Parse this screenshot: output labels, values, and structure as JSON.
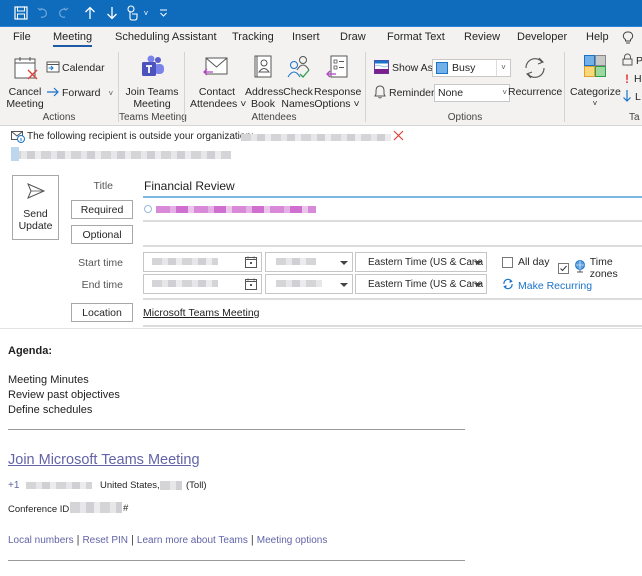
{
  "quick_access": {
    "icons": [
      "save-icon",
      "undo-icon",
      "redo-icon",
      "previous-item-icon",
      "next-item-icon",
      "touch-mode-icon",
      "touch-dropdown-icon",
      "customize-toolbar-icon"
    ]
  },
  "tabs": [
    {
      "label": "File",
      "active": false
    },
    {
      "label": "Meeting",
      "active": true
    },
    {
      "label": "Scheduling Assistant",
      "active": false
    },
    {
      "label": "Tracking",
      "active": false
    },
    {
      "label": "Insert",
      "active": false
    },
    {
      "label": "Draw",
      "active": false
    },
    {
      "label": "Format Text",
      "active": false
    },
    {
      "label": "Review",
      "active": false
    },
    {
      "label": "Developer",
      "active": false
    },
    {
      "label": "Help",
      "active": false
    }
  ],
  "ribbon": {
    "actions": {
      "group_label": "Actions",
      "cancel_line1": "Cancel",
      "cancel_line2": "Meeting",
      "calendar": "Calendar",
      "forward": "Forward"
    },
    "teams": {
      "group_label": "Teams Meeting",
      "join_line1": "Join Teams",
      "join_line2": "Meeting"
    },
    "attendees": {
      "group_label": "Attendees",
      "contact_line1": "Contact",
      "contact_line2": "Attendees",
      "address_line1": "Address",
      "address_line2": "Book",
      "check_line1": "Check",
      "check_line2": "Names",
      "response_line1": "Response",
      "response_line2": "Options"
    },
    "options": {
      "group_label": "Options",
      "show_as_label": "Show As:",
      "show_as_value": "Busy",
      "reminder_label": "Reminder:",
      "reminder_value": "None",
      "recurrence": "Recurrence"
    },
    "tags": {
      "group_label": "Ta",
      "categorize": "Categorize",
      "private": "P",
      "high": "H",
      "low": "L"
    }
  },
  "infobar": {
    "message": "The following recipient is outside your organization:"
  },
  "form": {
    "send_line1": "Send",
    "send_line2": "Update",
    "title_label": "Title",
    "title_value": "Financial Review",
    "required_label": "Required",
    "optional_label": "Optional",
    "start_time_label": "Start time",
    "end_time_label": "End time",
    "start_timezone": "Eastern Time (US & Cana",
    "end_timezone": "Eastern Time (US & Cana",
    "all_day_label": "All day",
    "all_day_checked": false,
    "time_zones_label": "Time zones",
    "time_zones_checked": true,
    "make_recurring": "Make Recurring",
    "location_label": "Location",
    "location_value": "Microsoft Teams Meeting"
  },
  "body": {
    "agenda_heading": "Agenda:",
    "agenda_items": [
      "Meeting Minutes",
      "Review past objectives",
      "Define schedules"
    ],
    "join_link": "Join Microsoft Teams Meeting",
    "phone_prefix": "+1",
    "phone_country": "United States,",
    "phone_toll": "(Toll)",
    "conference_label": "Conference ID:",
    "conference_suffix": "#",
    "footer_links": [
      "Local numbers",
      "Reset PIN",
      "Learn more about Teams",
      "Meeting options"
    ],
    "footer_separator": "|"
  },
  "colors": {
    "titlebar": "#0f6cbd",
    "teams_purple": "#6264a7",
    "accent_blue": "#1d5aa8"
  }
}
